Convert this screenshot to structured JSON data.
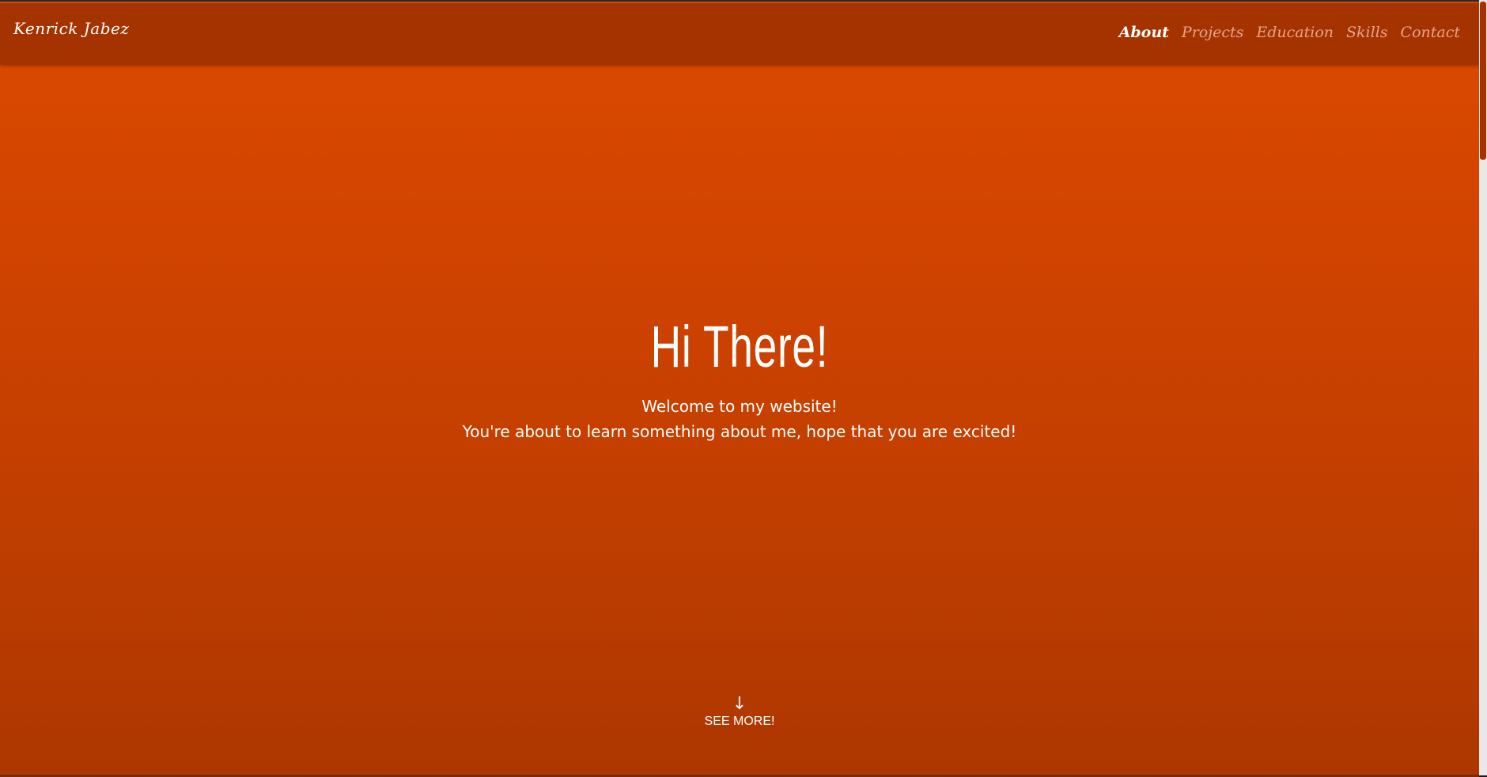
{
  "header": {
    "brand": "Kenrick Jabez",
    "nav": [
      {
        "label": "About",
        "active": true
      },
      {
        "label": "Projects",
        "active": false
      },
      {
        "label": "Education",
        "active": false
      },
      {
        "label": "Skills",
        "active": false
      },
      {
        "label": "Contact",
        "active": false
      }
    ]
  },
  "hero": {
    "title": "Hi There!",
    "line1": "Welcome to my website!",
    "line2": "You're about to learn something about me, hope that you are excited!"
  },
  "see_more": {
    "arrow_icon": "arrow-down-icon",
    "label": "SEE MORE!"
  },
  "colors": {
    "navbar": "#a53300",
    "accent": "#dc4a00",
    "text": "#ffffff"
  }
}
